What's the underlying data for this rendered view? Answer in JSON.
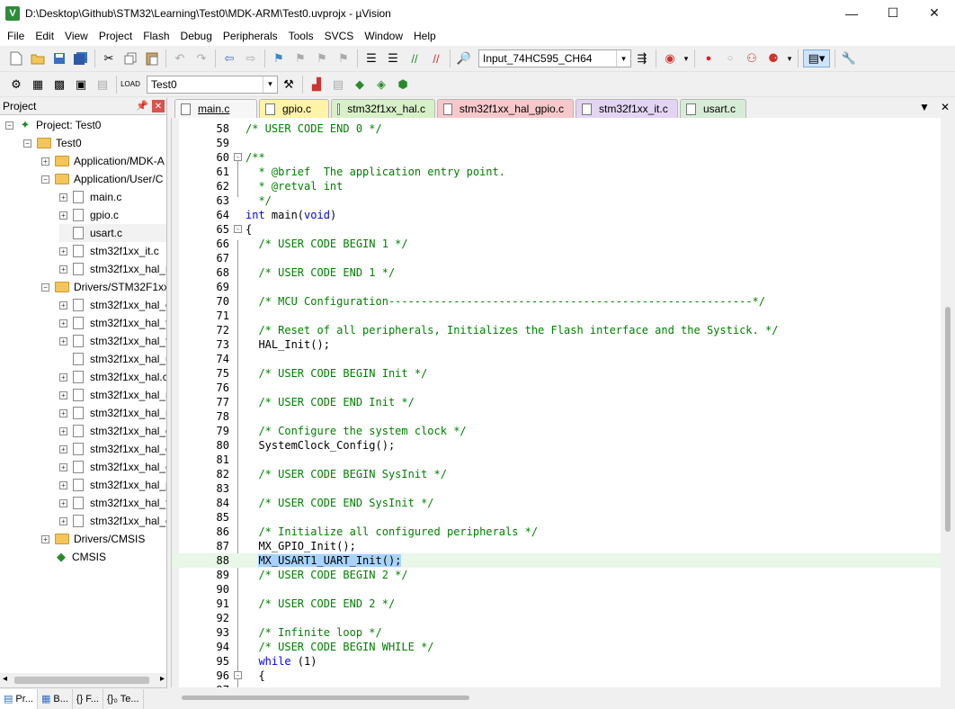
{
  "window": {
    "title": "D:\\Desktop\\Github\\STM32\\Learning\\Test0\\MDK-ARM\\Test0.uvprojx - µVision",
    "minimize": "—",
    "maximize": "☐",
    "close": "✕"
  },
  "menu": [
    "File",
    "Edit",
    "View",
    "Project",
    "Flash",
    "Debug",
    "Peripherals",
    "Tools",
    "SVCS",
    "Window",
    "Help"
  ],
  "toolbar": {
    "search_combo": "Input_74HC595_CH64",
    "target_combo": "Test0"
  },
  "project_panel": {
    "title": "Project",
    "tree": [
      {
        "label": "Project: Test0",
        "kind": "project"
      },
      {
        "label": "Test0",
        "kind": "target"
      },
      {
        "label": "Application/MDK-A",
        "kind": "folder"
      },
      {
        "label": "Application/User/C",
        "kind": "folder"
      },
      {
        "label": "main.c",
        "kind": "file"
      },
      {
        "label": "gpio.c",
        "kind": "file"
      },
      {
        "label": "usart.c",
        "kind": "file-selected"
      },
      {
        "label": "stm32f1xx_it.c",
        "kind": "file"
      },
      {
        "label": "stm32f1xx_hal_n",
        "kind": "file"
      },
      {
        "label": "Drivers/STM32F1xx",
        "kind": "folder"
      },
      {
        "label": "stm32f1xx_hal_g",
        "kind": "file"
      },
      {
        "label": "stm32f1xx_hal_t",
        "kind": "file"
      },
      {
        "label": "stm32f1xx_hal_t",
        "kind": "file"
      },
      {
        "label": "stm32f1xx_hal_u",
        "kind": "file"
      },
      {
        "label": "stm32f1xx_hal.c",
        "kind": "file"
      },
      {
        "label": "stm32f1xx_hal_r",
        "kind": "file"
      },
      {
        "label": "stm32f1xx_hal_r",
        "kind": "file"
      },
      {
        "label": "stm32f1xx_hal_g",
        "kind": "file"
      },
      {
        "label": "stm32f1xx_hal_d",
        "kind": "file"
      },
      {
        "label": "stm32f1xx_hal_c",
        "kind": "file"
      },
      {
        "label": "stm32f1xx_hal_p",
        "kind": "file"
      },
      {
        "label": "stm32f1xx_hal_f",
        "kind": "file"
      },
      {
        "label": "stm32f1xx_hal_e",
        "kind": "file"
      },
      {
        "label": "Drivers/CMSIS",
        "kind": "folder"
      },
      {
        "label": "CMSIS",
        "kind": "cmsis"
      }
    ]
  },
  "bottom_tabs": [
    "Pr...",
    "B...",
    "{} F...",
    "{}₀ Te..."
  ],
  "editor_tabs": [
    {
      "label": "main.c",
      "color": "#f6f6f6",
      "active": true
    },
    {
      "label": "gpio.c",
      "color": "#fff3a8",
      "active": false
    },
    {
      "label": "stm32f1xx_hal.c",
      "color": "#d8f0c8",
      "active": false
    },
    {
      "label": "stm32f1xx_hal_gpio.c",
      "color": "#f6c8cc",
      "active": false
    },
    {
      "label": "stm32f1xx_it.c",
      "color": "#e2d4f2",
      "active": false
    },
    {
      "label": "usart.c",
      "color": "#d7ecd7",
      "active": false
    }
  ],
  "code_lines": [
    {
      "n": "58",
      "t": "/* USER CODE END 0 */",
      "c": "cmt"
    },
    {
      "n": "59",
      "t": "",
      "c": ""
    },
    {
      "n": "60",
      "t": "/**",
      "c": "cmt",
      "fold": "-"
    },
    {
      "n": "61",
      "t": "  * @brief  The application entry point.",
      "c": "cmt"
    },
    {
      "n": "62",
      "t": "  * @retval int",
      "c": "cmt"
    },
    {
      "n": "63",
      "t": "  */",
      "c": "cmt"
    },
    {
      "n": "64",
      "t": "int main(void)",
      "c": "mixed-int"
    },
    {
      "n": "65",
      "t": "{",
      "c": "",
      "fold": "-"
    },
    {
      "n": "66",
      "t": "  /* USER CODE BEGIN 1 */",
      "c": "cmt"
    },
    {
      "n": "67",
      "t": "",
      "c": ""
    },
    {
      "n": "68",
      "t": "  /* USER CODE END 1 */",
      "c": "cmt"
    },
    {
      "n": "69",
      "t": "",
      "c": ""
    },
    {
      "n": "70",
      "t": "  /* MCU Configuration--------------------------------------------------------*/",
      "c": "cmt"
    },
    {
      "n": "71",
      "t": "",
      "c": ""
    },
    {
      "n": "72",
      "t": "  /* Reset of all peripherals, Initializes the Flash interface and the Systick. */",
      "c": "cmt"
    },
    {
      "n": "73",
      "t": "  HAL_Init();",
      "c": ""
    },
    {
      "n": "74",
      "t": "",
      "c": ""
    },
    {
      "n": "75",
      "t": "  /* USER CODE BEGIN Init */",
      "c": "cmt"
    },
    {
      "n": "76",
      "t": "",
      "c": ""
    },
    {
      "n": "77",
      "t": "  /* USER CODE END Init */",
      "c": "cmt"
    },
    {
      "n": "78",
      "t": "",
      "c": ""
    },
    {
      "n": "79",
      "t": "  /* Configure the system clock */",
      "c": "cmt"
    },
    {
      "n": "80",
      "t": "  SystemClock_Config();",
      "c": ""
    },
    {
      "n": "81",
      "t": "",
      "c": ""
    },
    {
      "n": "82",
      "t": "  /* USER CODE BEGIN SysInit */",
      "c": "cmt"
    },
    {
      "n": "83",
      "t": "",
      "c": ""
    },
    {
      "n": "84",
      "t": "  /* USER CODE END SysInit */",
      "c": "cmt"
    },
    {
      "n": "85",
      "t": "",
      "c": ""
    },
    {
      "n": "86",
      "t": "  /* Initialize all configured peripherals */",
      "c": "cmt"
    },
    {
      "n": "87",
      "t": "  MX_GPIO_Init();",
      "c": ""
    },
    {
      "n": "88",
      "t": "  MX_USART1_UART_Init();",
      "c": "",
      "highlight": true
    },
    {
      "n": "89",
      "t": "  /* USER CODE BEGIN 2 */",
      "c": "cmt"
    },
    {
      "n": "90",
      "t": "",
      "c": ""
    },
    {
      "n": "91",
      "t": "  /* USER CODE END 2 */",
      "c": "cmt"
    },
    {
      "n": "92",
      "t": "",
      "c": ""
    },
    {
      "n": "93",
      "t": "  /* Infinite loop */",
      "c": "cmt"
    },
    {
      "n": "94",
      "t": "  /* USER CODE BEGIN WHILE */",
      "c": "cmt"
    },
    {
      "n": "95",
      "t": "  while (1)",
      "c": "mixed-while"
    },
    {
      "n": "96",
      "t": "  {",
      "c": "",
      "fold": "-"
    },
    {
      "n": "97",
      "t": "",
      "c": ""
    }
  ]
}
